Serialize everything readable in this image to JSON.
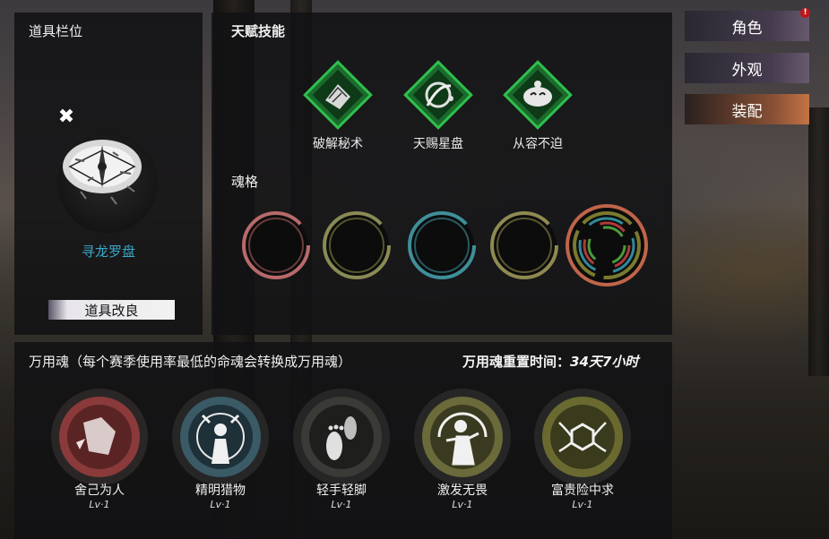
{
  "item_panel": {
    "title": "道具栏位",
    "item_name": "寻龙罗盘",
    "close_symbol": "✖",
    "upgrade_label": "道具改良"
  },
  "talent_panel": {
    "title": "天赋技能",
    "talents": [
      {
        "name": "破解秘术",
        "icon": "book-icon"
      },
      {
        "name": "天赐星盘",
        "icon": "astrolabe-icon"
      },
      {
        "name": "从容不迫",
        "icon": "calm-face-icon"
      }
    ],
    "soul_section_label": "魂格",
    "soul_slots": [
      {
        "color": "#b86a6a"
      },
      {
        "color": "#8a8a55"
      },
      {
        "color": "#3f8f99"
      },
      {
        "color": "#8f8a50"
      },
      {
        "color": "multicolor"
      }
    ]
  },
  "side_menu": {
    "items": [
      {
        "label": "角色",
        "active": false
      },
      {
        "label": "外观",
        "active": false
      },
      {
        "label": "装配",
        "active": true
      }
    ],
    "alert": "!"
  },
  "universal_souls": {
    "title": "万用魂（每个赛季使用率最低的命魂会转换成万用魂）",
    "reset_label": "万用魂重置时间：",
    "reset_value": "34天7小时",
    "souls": [
      {
        "name": "舍己为人",
        "level": "Lv·1",
        "color": "#8a3a3a"
      },
      {
        "name": "精明猎物",
        "level": "Lv·1",
        "color": "#3a5a66"
      },
      {
        "name": "轻手轻脚",
        "level": "Lv·1",
        "color": "#3a3a36"
      },
      {
        "name": "激发无畏",
        "level": "Lv·1",
        "color": "#6a6a3a"
      },
      {
        "name": "富贵险中求",
        "level": "Lv·1",
        "color": "#6a6a30"
      }
    ]
  }
}
